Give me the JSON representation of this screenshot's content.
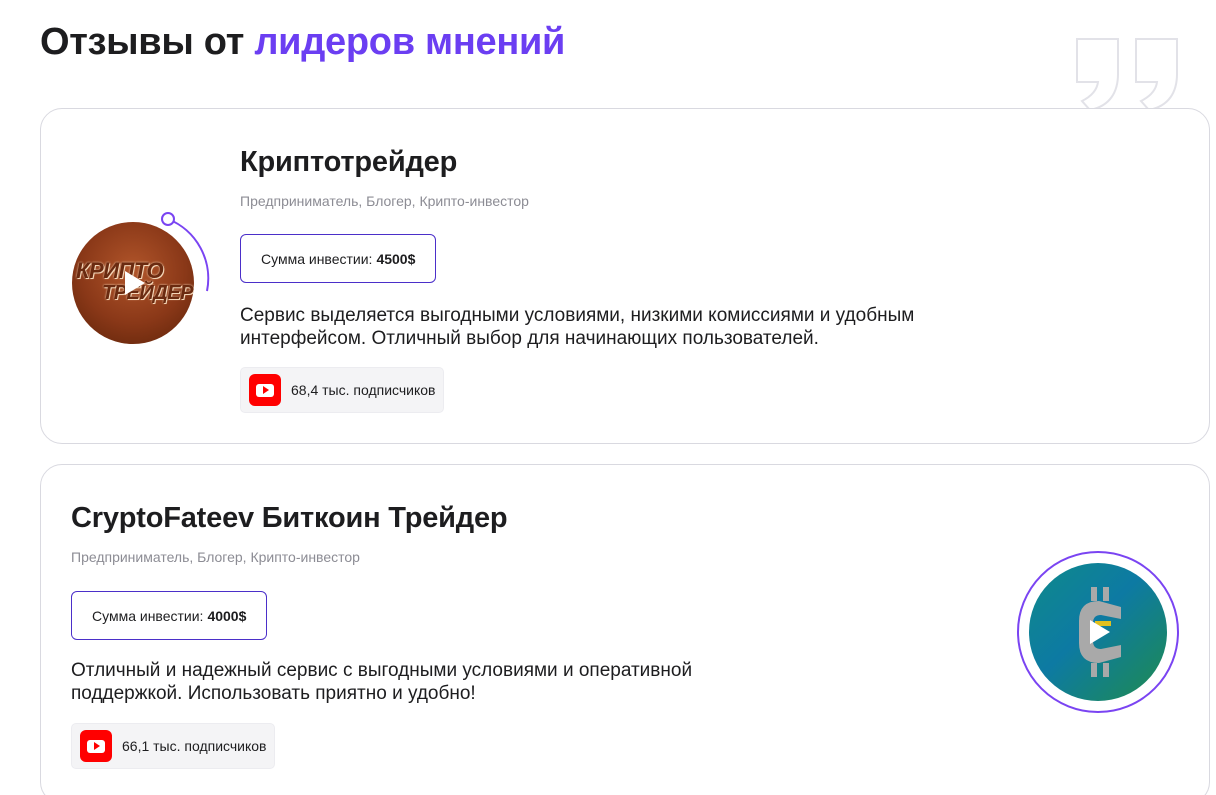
{
  "header": {
    "title_prefix": "Отзывы от",
    "title_accent": "лидеров мнений"
  },
  "colors": {
    "accent": "#6b3ef2",
    "border_accent": "#4b2fc9",
    "youtube": "#ff0000"
  },
  "reviews": [
    {
      "name": "Криптотрейдер",
      "roles": "Предприниматель, Блогер, Крипто-инвестор",
      "invest_label": "Сумма инвестии:",
      "invest_value": "4500$",
      "quote": "Сервис выделяется выгодными условиями, низкими комиссиями и удобным интерфейсом. Отличный выбор для начинающих пользователей.",
      "subscribers": "68,4 тыс. подписчиков",
      "platform_icon": "youtube-icon",
      "avatar_text_line1": "КРИПТО",
      "avatar_text_line2": "ТРЕЙДЕР"
    },
    {
      "name": "CryptoFateev Биткоин Трейдер",
      "roles": "Предприниматель, Блогер, Крипто-инвестор",
      "invest_label": "Сумма инвестии:",
      "invest_value": "4000$",
      "quote": "Отличный и надежный сервис с выгодными условиями и оперативной поддержкой. Использовать приятно и удобно!",
      "subscribers": "66,1 тыс. подписчиков",
      "platform_icon": "youtube-icon"
    }
  ]
}
